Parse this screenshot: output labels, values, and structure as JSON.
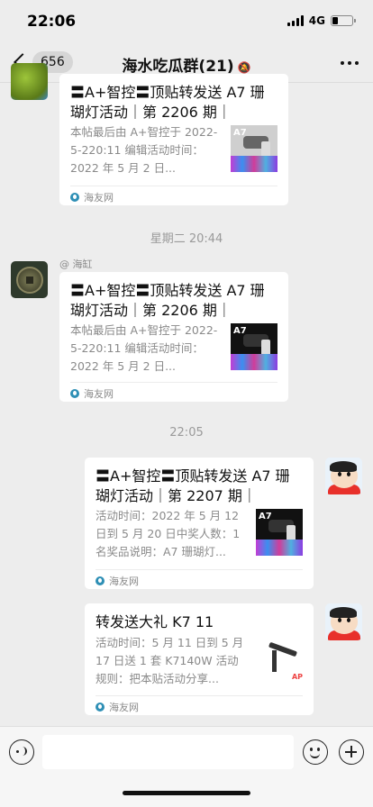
{
  "status_bar": {
    "time": "22:06",
    "network": "4G"
  },
  "nav": {
    "unread_count": "656",
    "title": "海水吃瓜群(21)"
  },
  "messages": [
    {
      "title": "〓A+智控〓顶贴转发送 A7 珊瑚灯活动｜第 2206 期｜",
      "desc": "本帖最后由 A+智控于 2022-5-220:11 编辑活动时间：2022 年 5 月 2 日...",
      "thumb_label": "A7",
      "source": "海友网"
    },
    {
      "sender": "@ 海缸",
      "title": "〓A+智控〓顶贴转发送 A7 珊瑚灯活动｜第 2206 期｜",
      "desc": "本帖最后由 A+智控于 2022-5-220:11 编辑活动时间：2022 年 5 月 2 日...",
      "thumb_label": "A7",
      "source": "海友网"
    },
    {
      "title": "〓A+智控〓顶贴转发送 A7 珊瑚灯活动｜第 2207 期｜",
      "desc": "活动时间：2022 年 5 月 12 日到 5 月 20 日中奖人数：1名奖品说明：A7 珊瑚灯...",
      "thumb_label": "A7",
      "source": "海友网"
    },
    {
      "title": "转发送大礼 K7 11",
      "desc": "活动时间：5 月 11 日到 5 月 17 日送 1 套 K7140W 活动规则：把本贴活动分享...",
      "thumb_label": "AP",
      "source": "海友网"
    }
  ],
  "timestamps": [
    "星期二 20:44",
    "22:05"
  ],
  "icons": {
    "back": "chevron-left-icon",
    "mute": "bell-off-icon",
    "more": "more-dots-icon",
    "voice": "voice-icon",
    "emoji": "emoji-icon",
    "plus": "plus-icon",
    "source": "haiyou-logo-icon"
  }
}
